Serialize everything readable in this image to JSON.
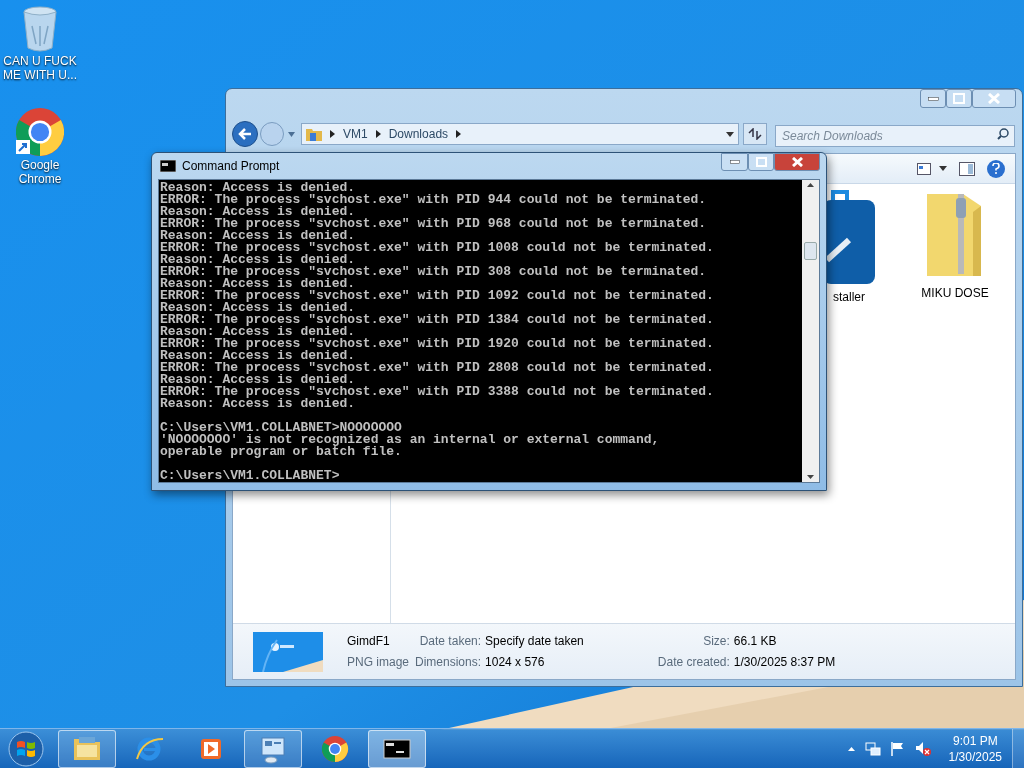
{
  "desktop_icons": [
    {
      "kind": "recycle-bin",
      "label": "CAN U FUCK ME WITH U..."
    },
    {
      "kind": "chrome",
      "label": "Google Chrome"
    }
  ],
  "explorer": {
    "breadcrumb": [
      "VM1",
      "Downloads"
    ],
    "search": {
      "placeholder": "Search Downloads"
    },
    "files": [
      {
        "kind": "installer",
        "label": "staller"
      },
      {
        "kind": "zip",
        "label": "MIKU DOSE"
      }
    ],
    "details": {
      "name": "GimdF1",
      "type": "PNG image",
      "fields": [
        {
          "label": "Date taken:",
          "value": "Specify date taken"
        },
        {
          "label": "Size:",
          "value": "66.1 KB"
        },
        {
          "label": "Dimensions:",
          "value": "1024 x 576"
        },
        {
          "label": "Date created:",
          "value": "1/30/2025 8:37 PM"
        }
      ]
    }
  },
  "console": {
    "title": "Command Prompt",
    "blocks": [
      [
        "Reason: Access is denied.",
        "ERROR: The process \"svchost.exe\" with PID 944 could not be terminated.",
        "Reason: Access is denied.",
        "ERROR: The process \"svchost.exe\" with PID 968 could not be terminated.",
        "Reason: Access is denied.",
        "ERROR: The process \"svchost.exe\" with PID 1008 could not be terminated.",
        "Reason: Access is denied.",
        "ERROR: The process \"svchost.exe\" with PID 308 could not be terminated.",
        "Reason: Access is denied.",
        "ERROR: The process \"svchost.exe\" with PID 1092 could not be terminated.",
        "Reason: Access is denied.",
        "ERROR: The process \"svchost.exe\" with PID 1384 could not be terminated.",
        "Reason: Access is denied.",
        "ERROR: The process \"svchost.exe\" with PID 1920 could not be terminated.",
        "Reason: Access is denied.",
        "ERROR: The process \"svchost.exe\" with PID 2808 could not be terminated.",
        "Reason: Access is denied.",
        "ERROR: The process \"svchost.exe\" with PID 3388 could not be terminated.",
        "Reason: Access is denied."
      ],
      [
        "C:\\Users\\VM1.COLLABNET>NOOOOOOO",
        "'NOOOOOOO' is not recognized as an internal or external command,",
        "operable program or batch file."
      ],
      [
        "C:\\Users\\VM1.COLLABNET>"
      ]
    ]
  },
  "taskbar": {
    "apps": [
      {
        "kind": "explorer",
        "open": true,
        "selected": false
      },
      {
        "kind": "ie",
        "open": false,
        "selected": false
      },
      {
        "kind": "media",
        "open": false,
        "selected": false
      },
      {
        "kind": "remote",
        "open": true,
        "selected": false
      },
      {
        "kind": "chrome",
        "open": false,
        "selected": false
      },
      {
        "kind": "console",
        "open": true,
        "selected": true
      }
    ],
    "clock": {
      "time": "9:01 PM",
      "date": "1/30/2025"
    }
  }
}
